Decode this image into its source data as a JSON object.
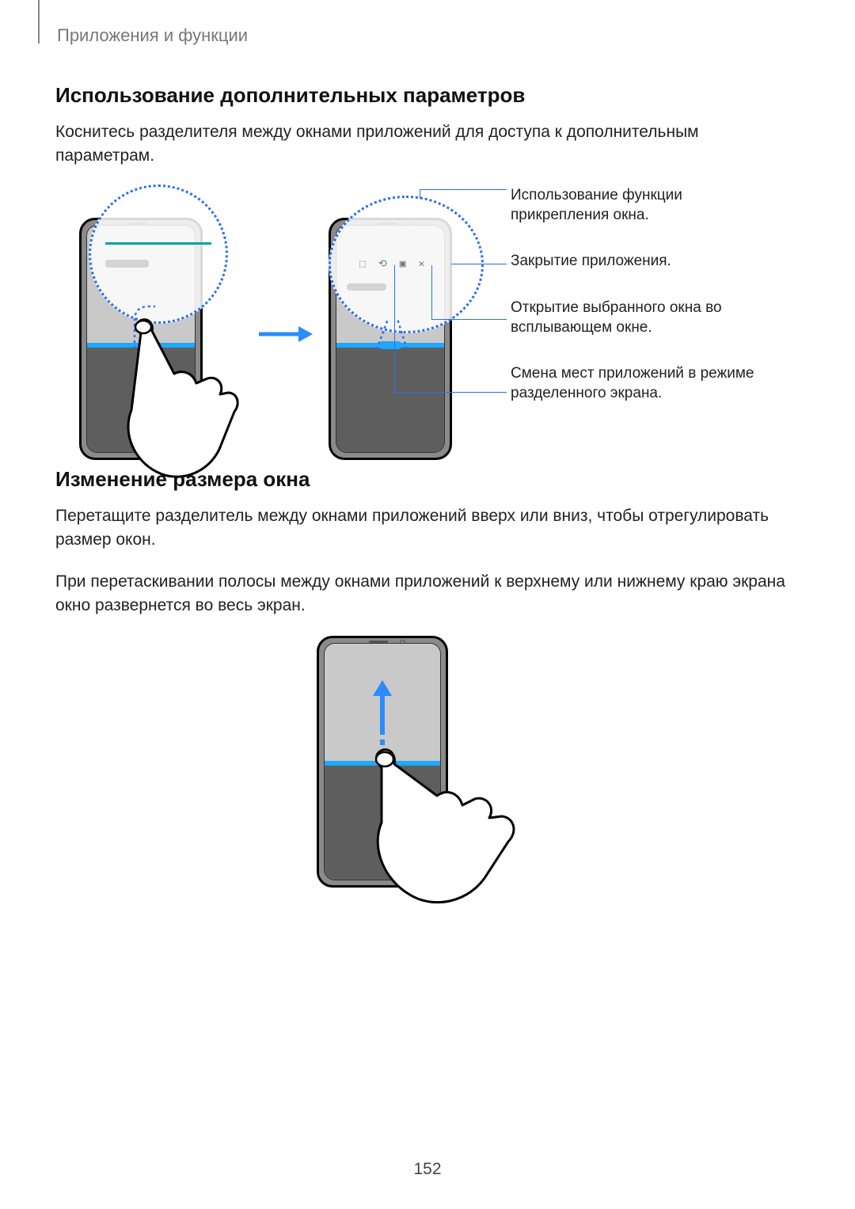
{
  "header": {
    "breadcrumb": "Приложения и функции"
  },
  "section1": {
    "title": "Использование дополнительных параметров",
    "p1": "Коснитесь разделителя между окнами приложений для доступа к дополнительным параметрам."
  },
  "callouts": {
    "c1": "Использование функции прикрепления окна.",
    "c2": "Закрытие приложения.",
    "c3": "Открытие выбранного окна во всплывающем окне.",
    "c4": "Смена мест приложений в режиме разделенного экрана."
  },
  "section2": {
    "title": "Изменение размера окна",
    "p1": "Перетащите разделитель между окнами приложений вверх или вниз, чтобы отрегулировать размер окон.",
    "p2": "При перетаскивании полосы между окнами приложений к верхнему или нижнему краю экрана окно развернется во весь экран."
  },
  "pageNumber": "152"
}
